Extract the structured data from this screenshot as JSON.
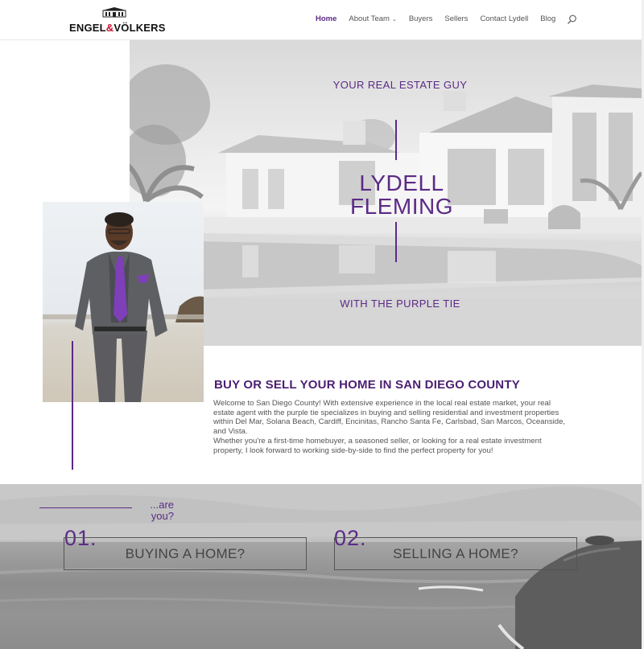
{
  "header": {
    "logo_text_left": "ENGEL",
    "logo_amp": "&",
    "logo_text_right": "VÖLKERS",
    "nav": [
      {
        "label": "Home",
        "active": true
      },
      {
        "label": "About Team",
        "has_dropdown": true
      },
      {
        "label": "Buyers"
      },
      {
        "label": "Sellers"
      },
      {
        "label": "Contact Lydell"
      },
      {
        "label": "Blog"
      }
    ]
  },
  "hero": {
    "tagline_top": "YOUR REAL ESTATE GUY",
    "name": "LYDELL FLEMING",
    "tagline_bottom": "WITH THE PURPLE TIE"
  },
  "intro": {
    "title": "BUY OR SELL YOUR HOME IN SAN DIEGO COUNTY",
    "paragraph1": "Welcome to San Diego County! With extensive experience in the local real estate market, your real estate agent with the purple tie specializes in buying and selling residential and investment properties within Del Mar, Solana Beach, Cardiff, Encinitas, Rancho Santa Fe, Carlsbad, San Marcos, Oceanside, and Vista.",
    "paragraph2": "Whether you're a first-time homebuyer, a seasoned seller, or looking for a real estate investment property, I look forward to working side-by-side to find the perfect property for you!"
  },
  "options": {
    "prompt_line1": "...are",
    "prompt_line2": "you?",
    "items": [
      {
        "number": "01.",
        "label": "BUYING A HOME?"
      },
      {
        "number": "02.",
        "label": "SELLING A HOME?"
      }
    ]
  },
  "colors": {
    "accent": "#5b2a86",
    "logo_amp": "#c8102e"
  }
}
